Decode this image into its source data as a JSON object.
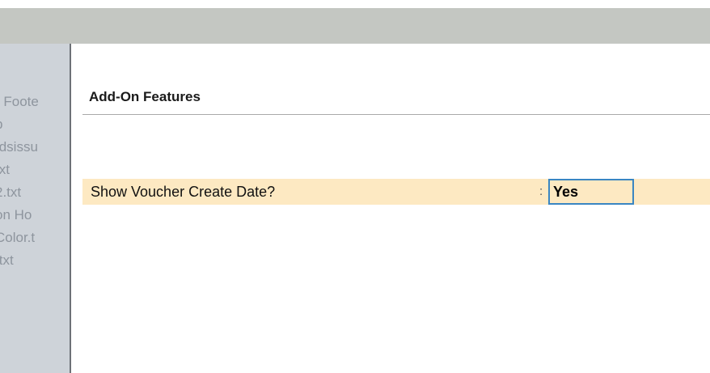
{
  "background_list": {
    "items": [
      "r Foote",
      "p",
      "tdsissu",
      "txt",
      "2.txt",
      "on Ho",
      "Color.t",
      ".txt"
    ]
  },
  "dialog": {
    "title": "Add-On Features",
    "field": {
      "label": "Show Voucher Create Date?",
      "separator": ":",
      "value": "Yes"
    }
  },
  "colors": {
    "header_band": "#c4c7c2",
    "background_panel": "#ced3d9",
    "highlight_row": "#fde9c2",
    "focus_border": "#3a86c2"
  }
}
